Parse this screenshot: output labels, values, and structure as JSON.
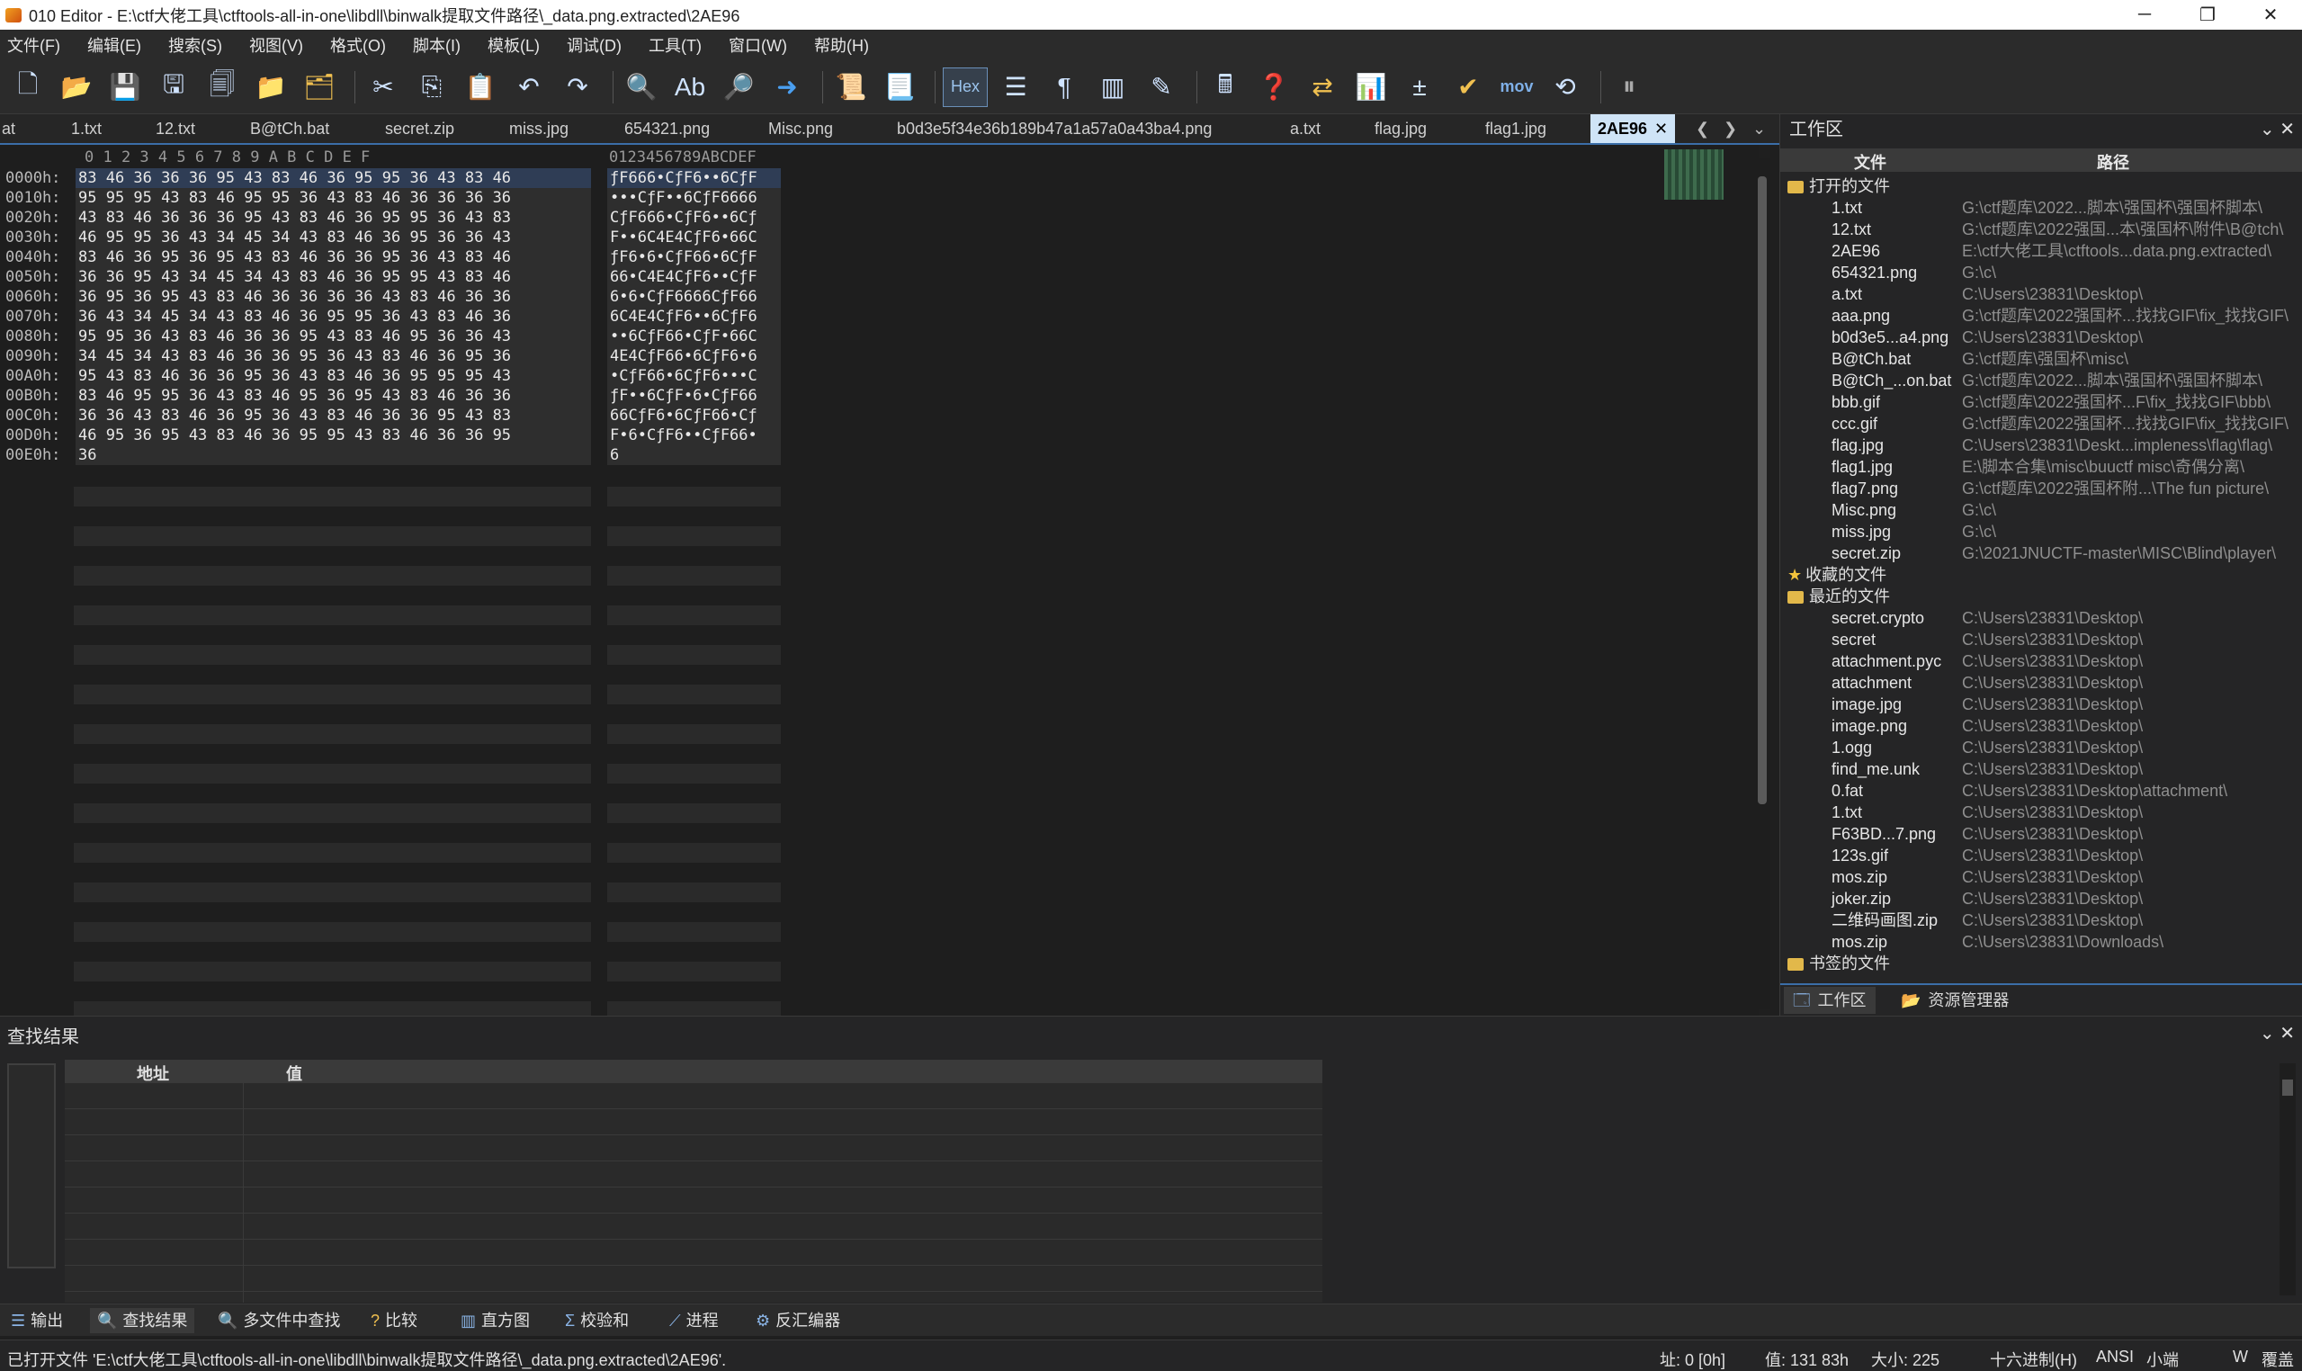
{
  "window": {
    "title": "010 Editor - E:\\ctf大佬工具\\ctftools-all-in-one\\libdll\\binwalk提取文件路径\\_data.png.extracted\\2AE96",
    "minimize": "─",
    "maximize": "❐",
    "close": "✕"
  },
  "menu": [
    "文件(F)",
    "编辑(E)",
    "搜索(S)",
    "视图(V)",
    "格式(O)",
    "脚本(I)",
    "模板(L)",
    "调试(D)",
    "工具(T)",
    "窗口(W)",
    "帮助(H)"
  ],
  "toolbar": {
    "hex_label": "Hex",
    "mov_label": "mov",
    "icons": [
      "new-file-icon",
      "open-file-icon",
      "save-icon",
      "save-as-icon",
      "save-all-icon",
      "open-folder-icon",
      "project-icon",
      "cut-icon",
      "copy-icon",
      "paste-icon",
      "undo-icon",
      "redo-icon",
      "find-icon",
      "replace-icon",
      "find-in-files-icon",
      "goto-icon",
      "run-script-icon",
      "run-template-icon",
      "hex-mode",
      "text-mode-icon",
      "pilcrow-icon",
      "columns-icon",
      "highlight-icon",
      "calculator-icon",
      "inspector-icon",
      "compare-icon",
      "histogram-icon",
      "checksum-icon",
      "check-icon",
      "mov-label",
      "base-convert-icon",
      "pause-icon"
    ]
  },
  "tabs": [
    "at",
    "1.txt",
    "12.txt",
    "B@tCh.bat",
    "secret.zip",
    "miss.jpg",
    "654321.png",
    "Misc.png",
    "b0d3e5f34e36b189b47a1a57a0a43ba4.png",
    "a.txt",
    "flag.jpg",
    "flag1.jpg",
    "2AE96"
  ],
  "active_tab_close": "✕",
  "tab_nav": {
    "prev": "❮",
    "next": "❯",
    "list": "⌄"
  },
  "hex": {
    "column_header": "0  1  2  3  4  5  6  7  8  9  A  B  C  D  E  F",
    "char_header": "0123456789ABCDEF",
    "rows": [
      {
        "addr": "0000h:",
        "bytes": "83 46 36 36 36 95 43 83 46 36 95 95 36 43 83 46",
        "chars": "ƒF666•CƒF6••6CƒF"
      },
      {
        "addr": "0010h:",
        "bytes": "95 95 95 43 83 46 95 95 36 43 83 46 36 36 36 36",
        "chars": "•••CƒF••6CƒF6666"
      },
      {
        "addr": "0020h:",
        "bytes": "43 83 46 36 36 36 95 43 83 46 36 95 95 36 43 83",
        "chars": "CƒF666•CƒF6••6Cƒ"
      },
      {
        "addr": "0030h:",
        "bytes": "46 95 95 36 43 34 45 34 43 83 46 36 95 36 36 43",
        "chars": "F••6C4E4CƒF6•66C"
      },
      {
        "addr": "0040h:",
        "bytes": "83 46 36 95 36 95 43 83 46 36 36 95 36 43 83 46",
        "chars": "ƒF6•6•CƒF66•6CƒF"
      },
      {
        "addr": "0050h:",
        "bytes": "36 36 95 43 34 45 34 43 83 46 36 95 95 43 83 46",
        "chars": "66•C4E4CƒF6••CƒF"
      },
      {
        "addr": "0060h:",
        "bytes": "36 95 36 95 43 83 46 36 36 36 36 43 83 46 36 36",
        "chars": "6•6•CƒF6666CƒF66"
      },
      {
        "addr": "0070h:",
        "bytes": "36 43 34 45 34 43 83 46 36 95 95 36 43 83 46 36",
        "chars": "6C4E4CƒF6••6CƒF6"
      },
      {
        "addr": "0080h:",
        "bytes": "95 95 36 43 83 46 36 36 95 43 83 46 95 36 36 43",
        "chars": "••6CƒF66•CƒF•66C"
      },
      {
        "addr": "0090h:",
        "bytes": "34 45 34 43 83 46 36 36 95 36 43 83 46 36 95 36",
        "chars": "4E4CƒF66•6CƒF6•6"
      },
      {
        "addr": "00A0h:",
        "bytes": "95 43 83 46 36 36 95 36 43 83 46 36 95 95 95 43",
        "chars": "•CƒF66•6CƒF6•••C"
      },
      {
        "addr": "00B0h:",
        "bytes": "83 46 95 95 36 43 83 46 95 36 95 43 83 46 36 36",
        "chars": "ƒF••6CƒF•6•CƒF66"
      },
      {
        "addr": "00C0h:",
        "bytes": "36 36 43 83 46 36 95 36 43 83 46 36 36 95 43 83",
        "chars": "66CƒF6•6CƒF66•Cƒ"
      },
      {
        "addr": "00D0h:",
        "bytes": "46 95 36 95 43 83 46 36 95 95 43 83 46 36 36 95",
        "chars": "F•6•CƒF6••CƒF66•"
      },
      {
        "addr": "00E0h:",
        "bytes": "36",
        "chars": "6"
      }
    ]
  },
  "workspace": {
    "title": "工作区",
    "controls": "⌄  ✕",
    "col_file": "文件",
    "col_path": "路径",
    "groups": {
      "open": "打开的文件",
      "favorites": "收藏的文件",
      "recent": "最近的文件",
      "bookmarks": "书签的文件"
    },
    "open_files": [
      {
        "name": "1.txt",
        "path": "G:\\ctf题库\\2022...脚本\\强国杯\\强国杯脚本\\"
      },
      {
        "name": "12.txt",
        "path": "G:\\ctf题库\\2022强国...本\\强国杯\\附件\\B@tch\\"
      },
      {
        "name": "2AE96",
        "path": "E:\\ctf大佬工具\\ctftools...data.png.extracted\\"
      },
      {
        "name": "654321.png",
        "path": "G:\\c\\"
      },
      {
        "name": "a.txt",
        "path": "C:\\Users\\23831\\Desktop\\"
      },
      {
        "name": "aaa.png",
        "path": "G:\\ctf题库\\2022强国杯...找找GIF\\fix_找找GIF\\"
      },
      {
        "name": "b0d3e5...a4.png",
        "path": "C:\\Users\\23831\\Desktop\\"
      },
      {
        "name": "B@tCh.bat",
        "path": "G:\\ctf题库\\强国杯\\misc\\"
      },
      {
        "name": "B@tCh_...on.bat",
        "path": "G:\\ctf题库\\2022...脚本\\强国杯\\强国杯脚本\\"
      },
      {
        "name": "bbb.gif",
        "path": "G:\\ctf题库\\2022强国杯...F\\fix_找找GIF\\bbb\\"
      },
      {
        "name": "ccc.gif",
        "path": "G:\\ctf题库\\2022强国杯...找找GIF\\fix_找找GIF\\"
      },
      {
        "name": "flag.jpg",
        "path": "C:\\Users\\23831\\Deskt...impleness\\flag\\flag\\"
      },
      {
        "name": "flag1.jpg",
        "path": "E:\\脚本合集\\misc\\buuctf misc\\奇偶分离\\"
      },
      {
        "name": "flag7.png",
        "path": "G:\\ctf题库\\2022强国杯附...\\The fun picture\\"
      },
      {
        "name": "Misc.png",
        "path": "G:\\c\\"
      },
      {
        "name": "miss.jpg",
        "path": "G:\\c\\"
      },
      {
        "name": "secret.zip",
        "path": "G:\\2021JNUCTF-master\\MISC\\Blind\\player\\"
      }
    ],
    "recent_files": [
      {
        "name": "secret.crypto",
        "path": "C:\\Users\\23831\\Desktop\\"
      },
      {
        "name": "secret",
        "path": "C:\\Users\\23831\\Desktop\\"
      },
      {
        "name": "attachment.pyc",
        "path": "C:\\Users\\23831\\Desktop\\"
      },
      {
        "name": "attachment",
        "path": "C:\\Users\\23831\\Desktop\\"
      },
      {
        "name": "image.jpg",
        "path": "C:\\Users\\23831\\Desktop\\"
      },
      {
        "name": "image.png",
        "path": "C:\\Users\\23831\\Desktop\\"
      },
      {
        "name": "1.ogg",
        "path": "C:\\Users\\23831\\Desktop\\"
      },
      {
        "name": "find_me.unk",
        "path": "C:\\Users\\23831\\Desktop\\"
      },
      {
        "name": "0.fat",
        "path": "C:\\Users\\23831\\Desktop\\attachment\\"
      },
      {
        "name": "1.txt",
        "path": "C:\\Users\\23831\\Desktop\\"
      },
      {
        "name": "F63BD...7.png",
        "path": "C:\\Users\\23831\\Desktop\\"
      },
      {
        "name": "123s.gif",
        "path": "C:\\Users\\23831\\Desktop\\"
      },
      {
        "name": "mos.zip",
        "path": "C:\\Users\\23831\\Desktop\\"
      },
      {
        "name": "joker.zip",
        "path": "C:\\Users\\23831\\Desktop\\"
      },
      {
        "name": "二维码画图.zip",
        "path": "C:\\Users\\23831\\Desktop\\"
      },
      {
        "name": "mos.zip",
        "path": "C:\\Users\\23831\\Downloads\\"
      }
    ],
    "tab_workspace": "工作区",
    "tab_explorer": "资源管理器"
  },
  "find": {
    "title": "查找结果",
    "controls": "⌄  ✕",
    "col_address": "地址",
    "col_value": "值"
  },
  "bottom_tabs": [
    {
      "icon": "☰",
      "label": "输出"
    },
    {
      "icon": "🔍",
      "label": "查找结果"
    },
    {
      "icon": "🔍",
      "label": "多文件中查找"
    },
    {
      "icon": "?",
      "label": "比较"
    },
    {
      "icon": "▥",
      "label": "直方图"
    },
    {
      "icon": "Σ",
      "label": "校验和"
    },
    {
      "icon": "⟋",
      "label": "进程"
    },
    {
      "icon": "⚙",
      "label": "反汇编器"
    }
  ],
  "status": {
    "message": "已打开文件 'E:\\ctf大佬工具\\ctftools-all-in-one\\libdll\\binwalk提取文件路径\\_data.png.extracted\\2AE96'.",
    "address": "址: 0 [0h]",
    "value": "值: 131 83h",
    "size": "大小: 225",
    "mode": "十六进制(H)",
    "encoding": "ANSI",
    "endian": "小端",
    "insert": "W",
    "overwrite": "覆盖"
  }
}
